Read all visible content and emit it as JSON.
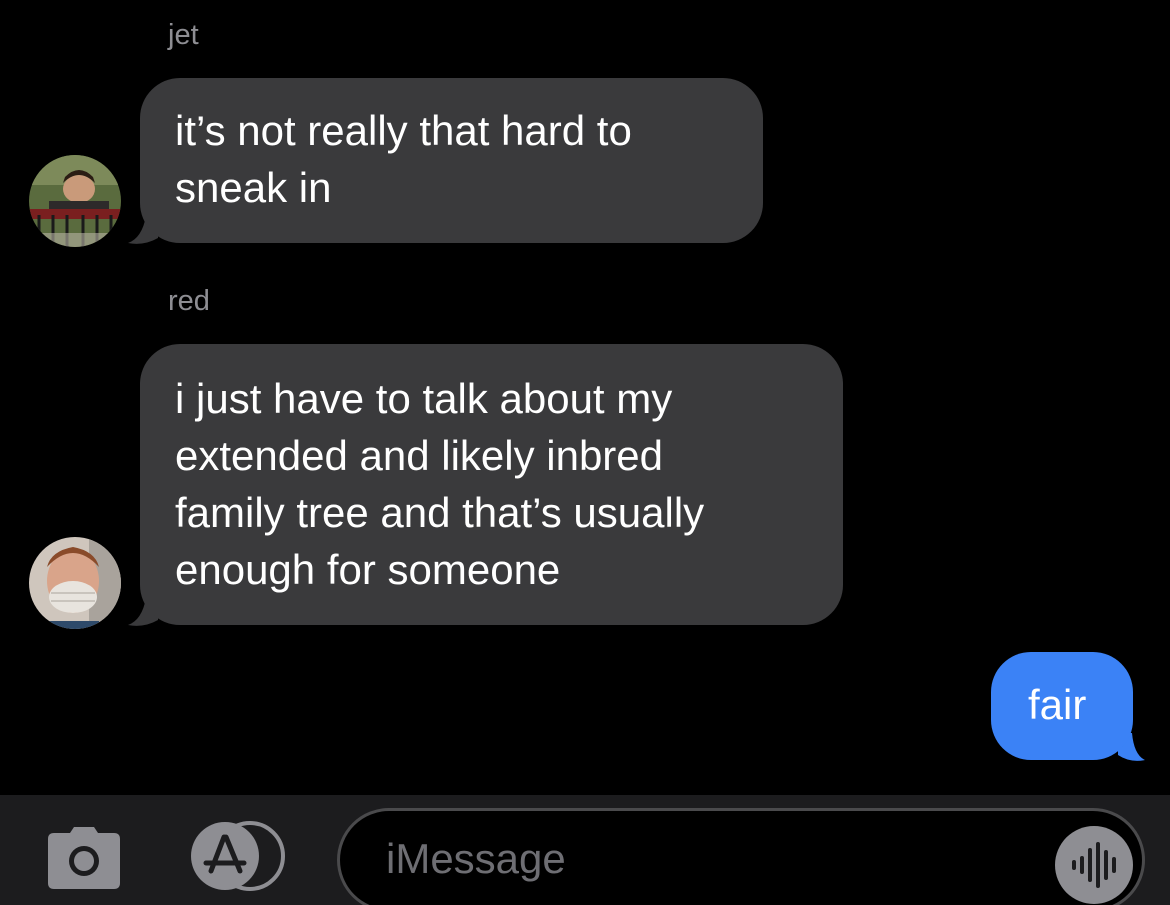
{
  "conversation": {
    "messages": [
      {
        "sender": "jet",
        "direction": "incoming",
        "lines": [
          "it’s not really that hard to",
          "sneak in"
        ],
        "avatar": "person-photo-avatar"
      },
      {
        "sender": "red",
        "direction": "incoming",
        "lines": [
          "i just have to talk about my",
          "extended and likely inbred",
          "family tree and that’s usually",
          "enough for someone"
        ],
        "avatar": "masked-person-photo-avatar"
      },
      {
        "sender": "",
        "direction": "outgoing",
        "lines": [
          "fair"
        ]
      }
    ]
  },
  "input_bar": {
    "camera_icon": "camera-icon",
    "apps_icon": "app-store-icon",
    "placeholder": "iMessage",
    "audio_icon": "audio-waveform-icon"
  },
  "colors": {
    "incoming_bubble": "#3a3a3c",
    "outgoing_bubble": "#3b82f6",
    "background": "#000000",
    "sender_name": "#8e8e93"
  }
}
